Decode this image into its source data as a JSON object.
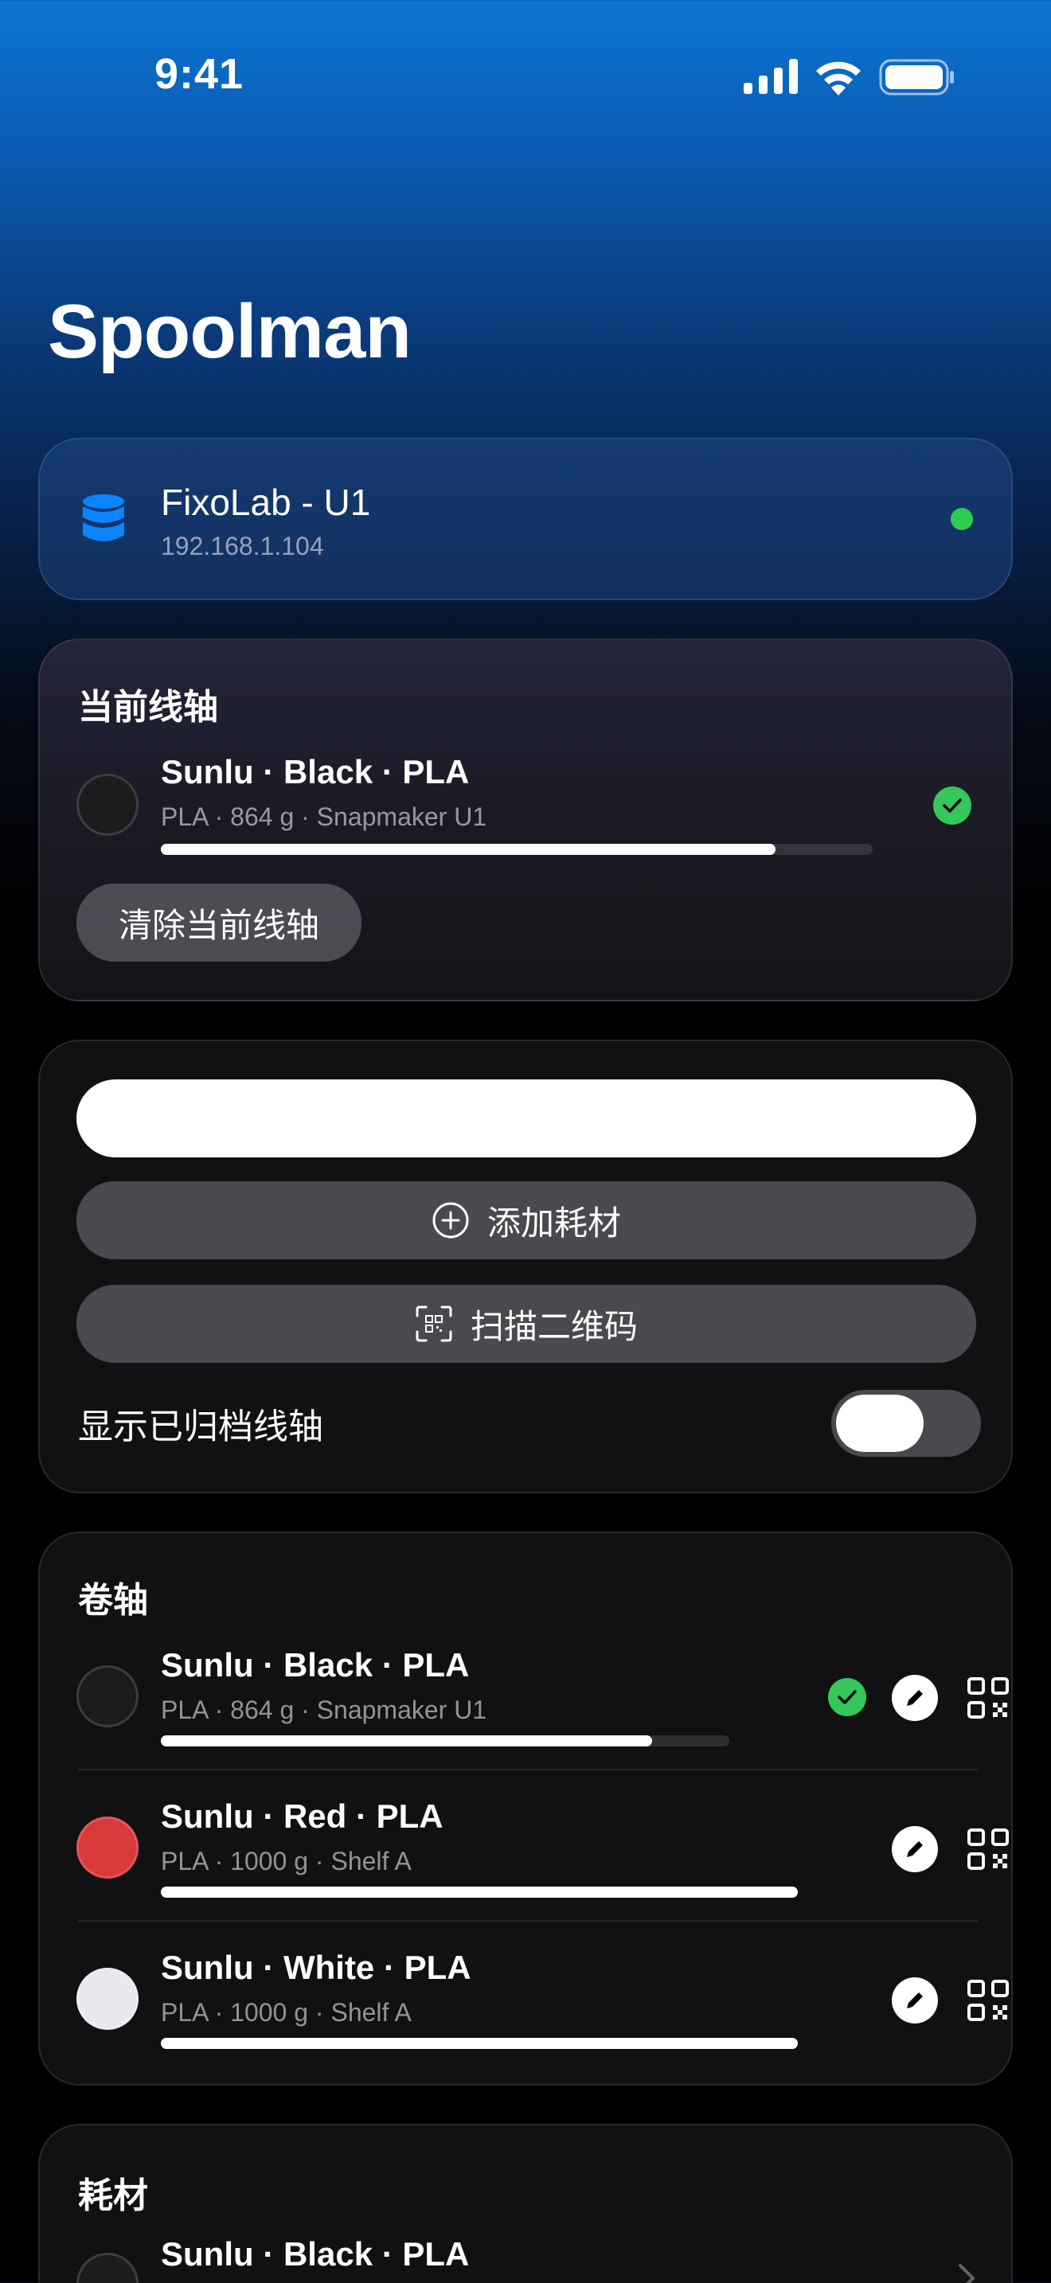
{
  "status_bar": {
    "time": "9:41"
  },
  "page": {
    "title": "Spoolman"
  },
  "server": {
    "name": "FixoLab - U1",
    "address": "192.168.1.104",
    "status_color": "#2ecc4f"
  },
  "current_spool": {
    "section_title": "当前线轴",
    "title": "Sunlu · Black · PLA",
    "subtitle": "PLA · 864 g · Snapmaker U1",
    "remaining_fraction": 0.864,
    "color": "#1c1c1e",
    "clear_label": "清除当前线轴"
  },
  "actions": {
    "search_value": "",
    "add_label": "添加耗材",
    "scan_label": "扫描二维码",
    "show_archived_label": "显示已归档线轴",
    "show_archived": false
  },
  "spools": {
    "section_title": "卷轴",
    "items": [
      {
        "title": "Sunlu · Black · PLA",
        "subtitle": "PLA · 864 g · Snapmaker U1",
        "remaining_fraction": 0.864,
        "color": "#1c1c1e",
        "active": true
      },
      {
        "title": "Sunlu · Red · PLA",
        "subtitle": "PLA · 1000 g · Shelf A",
        "remaining_fraction": 1.0,
        "color": "#d9393b",
        "active": false
      },
      {
        "title": "Sunlu · White · PLA",
        "subtitle": "PLA · 1000 g · Shelf A",
        "remaining_fraction": 1.0,
        "color": "#e8eaef",
        "active": false
      }
    ]
  },
  "filaments": {
    "section_title": "耗材",
    "items": [
      {
        "title": "Sunlu · Black · PLA",
        "color": "#1c1c1e"
      }
    ]
  },
  "colors": {
    "accent": "#0a84ff",
    "success": "#34c759"
  }
}
